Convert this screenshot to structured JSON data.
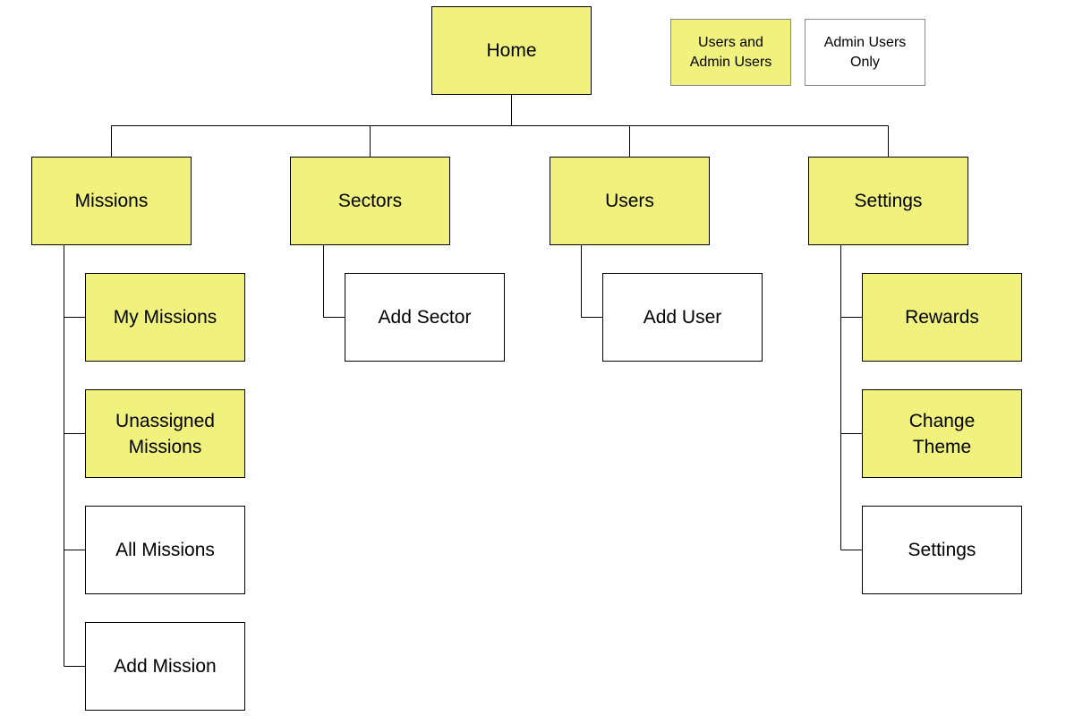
{
  "colors": {
    "users_and_admin": "#f0f27d",
    "admin_only": "#ffffff",
    "line": "#000000"
  },
  "legend": {
    "users_and_admin": "Users and\nAdmin Users",
    "admin_only": "Admin Users\nOnly"
  },
  "root": "Home",
  "sections": [
    {
      "label": "Missions",
      "children": [
        "My Missions",
        "Unassigned\nMissions",
        "All Missions",
        "Add Mission"
      ]
    },
    {
      "label": "Sectors",
      "children": [
        "Add Sector"
      ]
    },
    {
      "label": "Users",
      "children": [
        "Add User"
      ]
    },
    {
      "label": "Settings",
      "children": [
        "Rewards",
        "Change\nTheme",
        "Settings"
      ]
    }
  ]
}
